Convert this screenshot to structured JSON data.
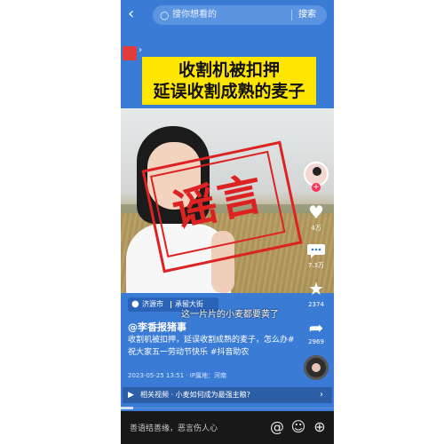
{
  "search": {
    "placeholder": "搜你想看的",
    "button": "搜索"
  },
  "headline": {
    "line1": "收割机被扣押",
    "line2": "延误收割成熟的麦子"
  },
  "stamp": {
    "text": "谣言"
  },
  "rail": {
    "likes": "4万",
    "comments": "7.3万",
    "favorites": "2374",
    "shares": "2969"
  },
  "location": {
    "city": "济源市",
    "place": "承留大街"
  },
  "caption": "这一片片的小麦都要黄了",
  "post": {
    "author": "@李香报猪事",
    "description": "收割机被扣押，延误收割成熟的麦子，怎么办#祝大家五一劳动节快乐 #抖音助农",
    "date": "2023-05-25 13:51 · IP属地：河南"
  },
  "related": {
    "text": "相关视频 · 小麦如何成为最强主粮?"
  },
  "progress": {
    "fraction": 0.06
  },
  "comment": {
    "placeholder": "善语结善缘，恶言伤人心"
  },
  "colors": {
    "app_blue": "#3a7bd5",
    "stamp_red": "#dd2222",
    "headline_yellow": "#ffe600"
  },
  "icons": {
    "back": "back-arrow-icon",
    "search": "search-icon",
    "like": "heart-icon",
    "comment": "comment-icon",
    "favorite": "star-icon",
    "share": "share-icon",
    "location": "location-pin-icon",
    "at": "at-icon",
    "emoji": "emoji-icon",
    "add": "add-icon"
  }
}
